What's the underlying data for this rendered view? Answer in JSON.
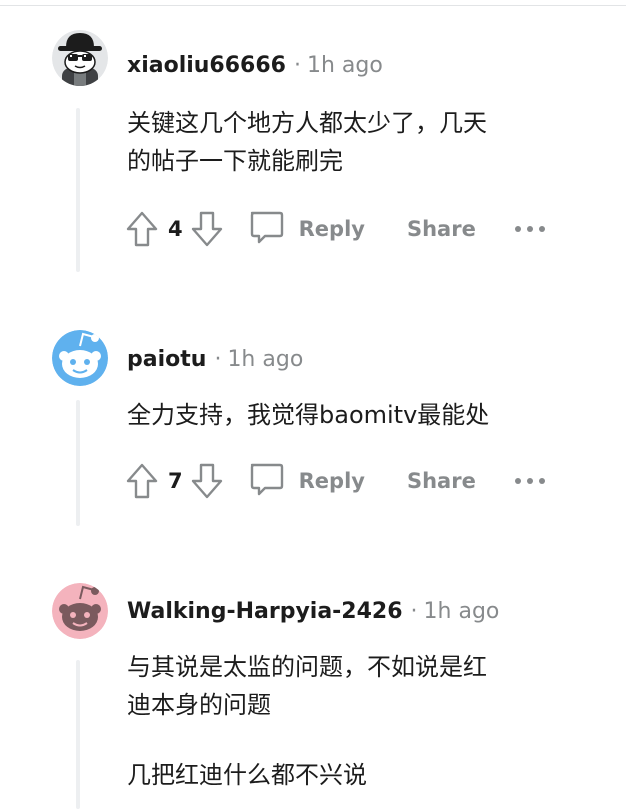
{
  "comments": [
    {
      "author": "xiaoliu66666",
      "time": "1h ago",
      "avatar_icon": "snoo-sunglasses-hat-avatar-icon",
      "paragraphs": [
        "关键这几个地方人都太少了，几天",
        "的帖子一下就能刷完"
      ],
      "votes": "4",
      "reply_label": "Reply",
      "share_label": "Share",
      "more_icon": "more-horizontal-icon"
    },
    {
      "author": "paiotu",
      "time": "1h ago",
      "avatar_icon": "snoo-default-blue-avatar-icon",
      "paragraphs": [
        "全力支持，我觉得baomitv最能处"
      ],
      "votes": "7",
      "reply_label": "Reply",
      "share_label": "Share",
      "more_icon": "more-horizontal-icon"
    },
    {
      "author": "Walking-Harpyia-2426",
      "time": "1h ago",
      "avatar_icon": "snoo-default-pink-avatar-icon",
      "paragraphs": [
        "与其说是太监的问题，不如说是红",
        "迪本身的问题",
        "几把红迪什么都不兴说"
      ]
    }
  ],
  "separator": "·",
  "colors": {
    "text": "#1c1c1c",
    "meta_gray": "#878a8c",
    "thread_line": "#edeff1",
    "avatar_blue": "#5fb1ee",
    "avatar_pink": "#f4b3bd",
    "avatar_gray": "#e4e6e8"
  }
}
